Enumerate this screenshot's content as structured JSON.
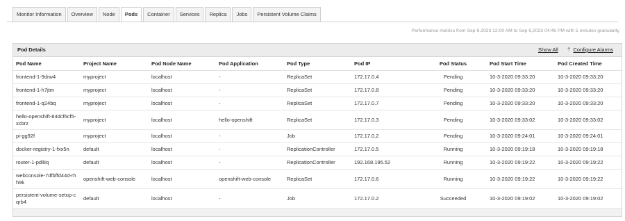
{
  "tabs": [
    {
      "label": "Monitor Information",
      "active": false
    },
    {
      "label": "Overview",
      "active": false
    },
    {
      "label": "Node",
      "active": false
    },
    {
      "label": "Pods",
      "active": true
    },
    {
      "label": "Container",
      "active": false
    },
    {
      "label": "Services",
      "active": false
    },
    {
      "label": "Replica",
      "active": false
    },
    {
      "label": "Jobs",
      "active": false
    },
    {
      "label": "Persistent Volume Claims",
      "active": false
    }
  ],
  "performance_note": "Performance metrics from Sep 6,2023 12:00 AM to Sep 6,2023 04:46 PM with 5 minutes granularity",
  "panel": {
    "title": "Pod Details",
    "show_all": "Show All",
    "configure_alarms": "Configure Alarms"
  },
  "table": {
    "columns": [
      "Pod Name",
      "Project Name",
      "Pod Node Name",
      "Pod Application",
      "Pod Type",
      "Pod IP",
      "Pod Status",
      "Pod Start Time",
      "Pod Created Time"
    ],
    "rows": [
      [
        "frontend-1-9drw4",
        "myproject",
        "localhost",
        "-",
        "ReplicaSet",
        "172.17.0.4",
        "Pending",
        "10-3-2020 09:33:20",
        "10-3-2020 09:33:20"
      ],
      [
        "frontend-1-h7jtm",
        "myproject",
        "localhost",
        "-",
        "ReplicaSet",
        "172.17.0.8",
        "Pending",
        "10-3-2020 09:33:20",
        "10-3-2020 09:33:20"
      ],
      [
        "frontend-1-q24bq",
        "myproject",
        "localhost",
        "-",
        "ReplicaSet",
        "172.17.0.7",
        "Pending",
        "10-3-2020 09:33:20",
        "10-3-2020 09:33:20"
      ],
      [
        "hello-openshift-84dcf6cf5-xcbrz",
        "myproject",
        "localhost",
        "hello-openshift",
        "ReplicaSet",
        "172.17.0.3",
        "Pending",
        "10-3-2020 09:33:02",
        "10-3-2020 09:33:02"
      ],
      [
        "pi-gg92f",
        "myproject",
        "localhost",
        "-",
        "Job",
        "172.17.0.2",
        "Pending",
        "10-3-2020 09:24:01",
        "10-3-2020 09:24:01"
      ],
      [
        "docker-registry-1-fxx5n",
        "default",
        "localhost",
        "-",
        "ReplicationController",
        "172.17.0.5",
        "Running",
        "10-3-2020 09:19:18",
        "10-3-2020 09:19:18"
      ],
      [
        "router-1-pdl8q",
        "default",
        "localhost",
        "-",
        "ReplicationController",
        "192.168.195.52",
        "Running",
        "10-3-2020 09:19:22",
        "10-3-2020 09:19:22"
      ],
      [
        "webconsole-7dfbffd44d-rhh9k",
        "openshift-web-console",
        "localhost",
        "openshift-web-console",
        "ReplicaSet",
        "172.17.0.6",
        "Running",
        "10-3-2020 09:19:22",
        "10-3-2020 09:19:22"
      ],
      [
        "persistent-volume-setup-cqrb4",
        "default",
        "localhost",
        "-",
        "Job",
        "172.17.0.2",
        "Succeeded",
        "10-3-2020 09:19:02",
        "10-3-2020 09:19:02"
      ]
    ]
  },
  "icons": {
    "configure_alarms": "alarm-config-icon"
  }
}
